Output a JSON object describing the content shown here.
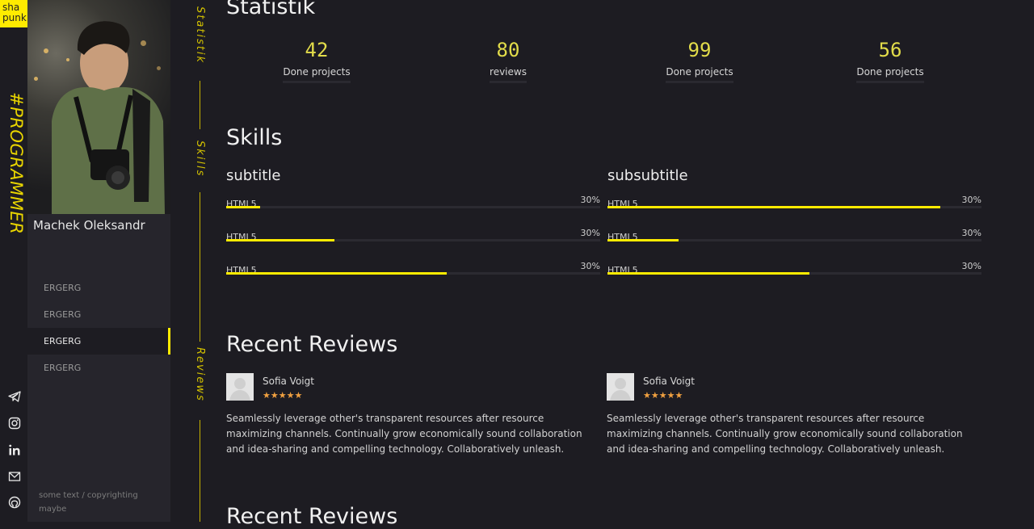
{
  "brand": {
    "logo_line1": "sha",
    "logo_line2": "punk",
    "hashtag": "#PROGRAMMER"
  },
  "social_icons": [
    "telegram-icon",
    "instagram-icon",
    "linkedin-icon",
    "mail-icon",
    "github-icon"
  ],
  "profile": {
    "name": "Machek Oleksandr",
    "nav": [
      {
        "label": "ERGERG",
        "active": false
      },
      {
        "label": "ERGERG",
        "active": false
      },
      {
        "label": "ERGERG",
        "active": true
      },
      {
        "label": "ERGERG",
        "active": false
      }
    ],
    "copyright": "some text / copyrighting maybe"
  },
  "section_labels": [
    "Statistik",
    "Skills",
    "Reviews"
  ],
  "statistik": {
    "title": "Statistik",
    "items": [
      {
        "value": "42",
        "label": "Done projects"
      },
      {
        "value": "80",
        "label": "reviews"
      },
      {
        "value": "99",
        "label": "Done projects"
      },
      {
        "value": "56",
        "label": "Done projects"
      }
    ]
  },
  "skills": {
    "title": "Skills",
    "columns": [
      {
        "title": "subtitle",
        "items": [
          {
            "name": "HTML5",
            "percent_label": "30%",
            "fill": 0.09
          },
          {
            "name": "HTML5",
            "percent_label": "30%",
            "fill": 0.29
          },
          {
            "name": "HTML5",
            "percent_label": "30%",
            "fill": 0.59
          }
        ]
      },
      {
        "title": "subsubtitle",
        "items": [
          {
            "name": "HTML5",
            "percent_label": "30%",
            "fill": 0.89
          },
          {
            "name": "HTML5",
            "percent_label": "30%",
            "fill": 0.19
          },
          {
            "name": "HTML5",
            "percent_label": "30%",
            "fill": 0.54
          }
        ]
      }
    ]
  },
  "reviews": {
    "title": "Recent Reviews",
    "title2": "Recent Reviews",
    "items": [
      {
        "name": "Sofia Voigt",
        "stars": "★★★★★",
        "rating": 5,
        "text": "Seamlessly leverage other's transparent resources after resource maximizing channels. Continually grow economically sound collaboration and idea-sharing and compelling technology. Collaboratively unleash."
      },
      {
        "name": "Sofia Voigt",
        "stars": "★★★★★",
        "rating": 5,
        "text": "Seamlessly leverage other's transparent resources after resource maximizing channels. Continually grow economically sound collaboration and idea-sharing and compelling technology. Collaboratively unleash."
      }
    ]
  },
  "colors": {
    "accent": "#ffeb00",
    "background": "#1d1c22",
    "sidebar": "#26252c",
    "star": "#f0a040"
  }
}
